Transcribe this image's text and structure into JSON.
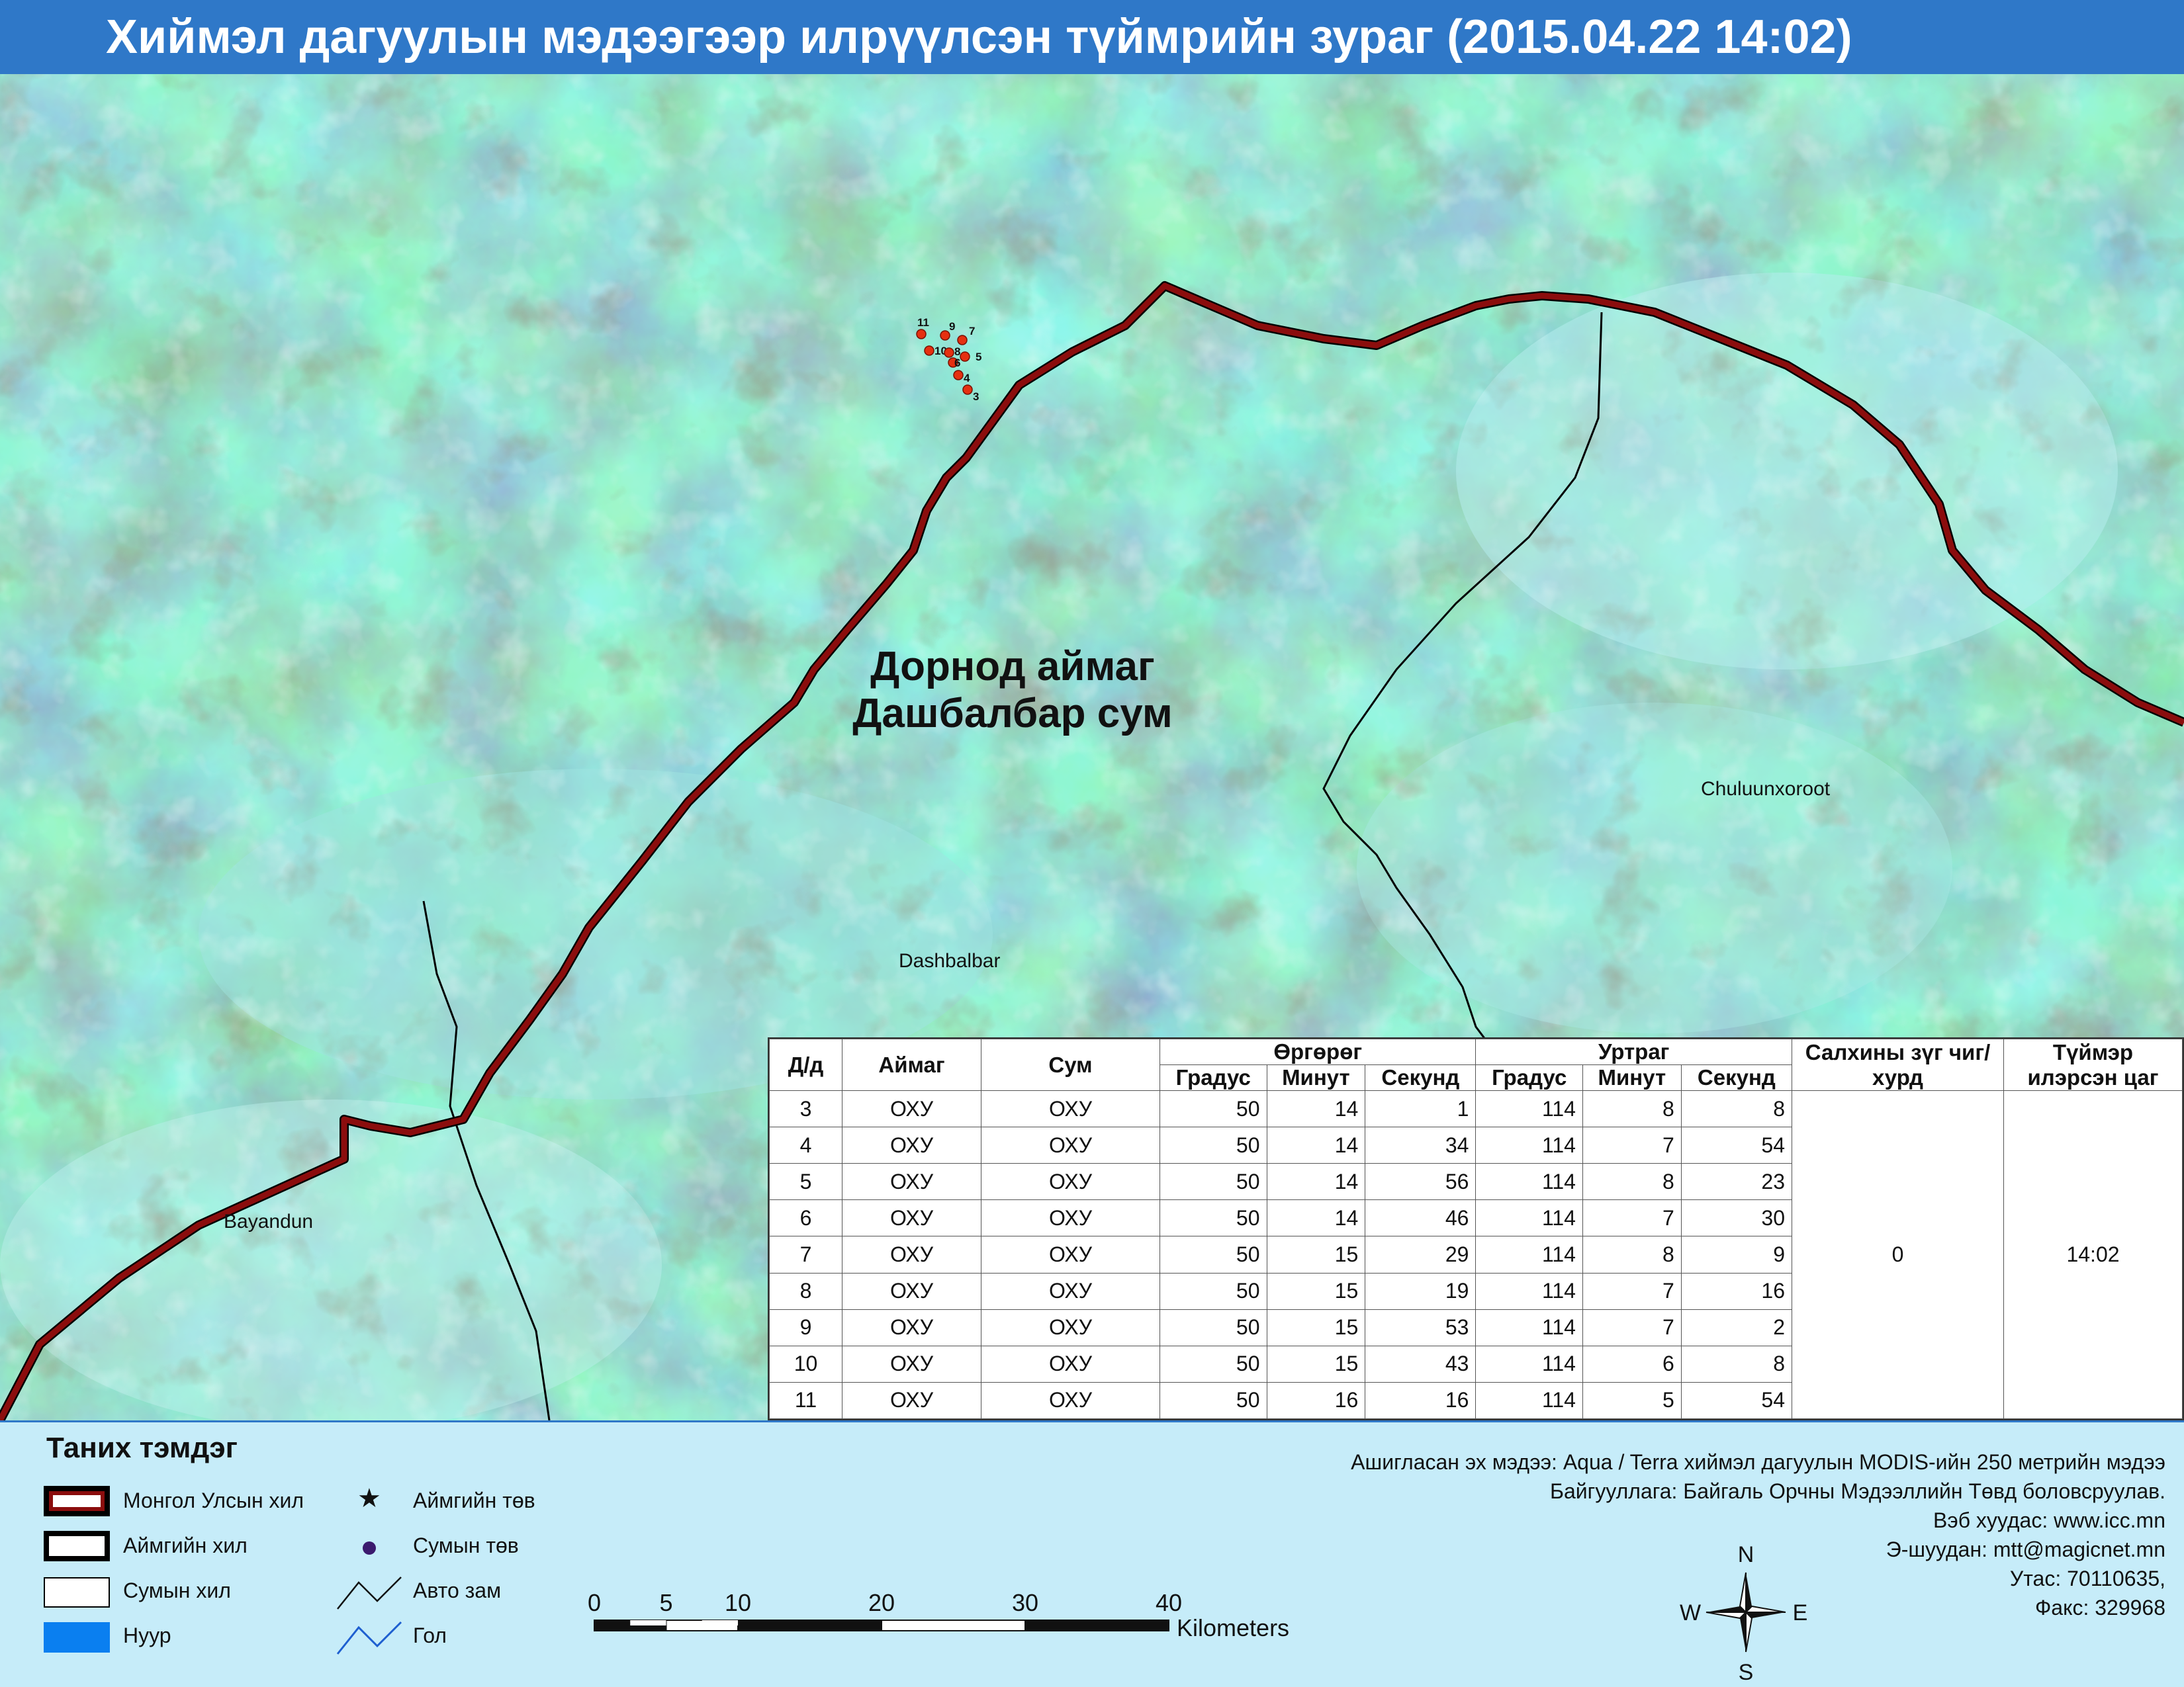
{
  "title": "Хиймэл дагуулын мэдээгээр илрүүлсэн түймрийн зураг  (2015.04.22 14:02)",
  "map": {
    "region_label_line1": "Дорнод аймаг",
    "region_label_line2": "Дашбалбар сум",
    "place_labels": {
      "chuluunxoroot": "Chuluunxoroot",
      "dashbalbar": "Dashbalbar",
      "bayandun": "Bayandun"
    },
    "fire_points": [
      "11",
      "9",
      "7",
      "10",
      "8",
      "5",
      "6",
      "4",
      "3"
    ],
    "colors": {
      "national_border": "#8b0d0d",
      "fire_point": "#e53010",
      "fire_label": "#111111",
      "soum_border": "#000000"
    }
  },
  "table": {
    "headers": {
      "no": "Д/д",
      "aimag": "Аймаг",
      "soum": "Сум",
      "latitude": "Өргөрөг",
      "longitude": "Уртраг",
      "degree": "Градус",
      "minute": "Минут",
      "second": "Секунд",
      "wind": "Салхины зүг чиг/хурд",
      "time": "Түймэр илэрсэн цаг"
    },
    "rows": [
      {
        "no": "3",
        "aimag": "ОХУ",
        "soum": "ОХУ",
        "lat_d": "50",
        "lat_m": "14",
        "lat_s": "1",
        "lon_d": "114",
        "lon_m": "8",
        "lon_s": "8"
      },
      {
        "no": "4",
        "aimag": "ОХУ",
        "soum": "ОХУ",
        "lat_d": "50",
        "lat_m": "14",
        "lat_s": "34",
        "lon_d": "114",
        "lon_m": "7",
        "lon_s": "54"
      },
      {
        "no": "5",
        "aimag": "ОХУ",
        "soum": "ОХУ",
        "lat_d": "50",
        "lat_m": "14",
        "lat_s": "56",
        "lon_d": "114",
        "lon_m": "8",
        "lon_s": "23"
      },
      {
        "no": "6",
        "aimag": "ОХУ",
        "soum": "ОХУ",
        "lat_d": "50",
        "lat_m": "14",
        "lat_s": "46",
        "lon_d": "114",
        "lon_m": "7",
        "lon_s": "30"
      },
      {
        "no": "7",
        "aimag": "ОХУ",
        "soum": "ОХУ",
        "lat_d": "50",
        "lat_m": "15",
        "lat_s": "29",
        "lon_d": "114",
        "lon_m": "8",
        "lon_s": "9"
      },
      {
        "no": "8",
        "aimag": "ОХУ",
        "soum": "ОХУ",
        "lat_d": "50",
        "lat_m": "15",
        "lat_s": "19",
        "lon_d": "114",
        "lon_m": "7",
        "lon_s": "16"
      },
      {
        "no": "9",
        "aimag": "ОХУ",
        "soum": "ОХУ",
        "lat_d": "50",
        "lat_m": "15",
        "lat_s": "53",
        "lon_d": "114",
        "lon_m": "7",
        "lon_s": "2"
      },
      {
        "no": "10",
        "aimag": "ОХУ",
        "soum": "ОХУ",
        "lat_d": "50",
        "lat_m": "15",
        "lat_s": "43",
        "lon_d": "114",
        "lon_m": "6",
        "lon_s": "8"
      },
      {
        "no": "11",
        "aimag": "ОХУ",
        "soum": "ОХУ",
        "lat_d": "50",
        "lat_m": "16",
        "lat_s": "16",
        "lon_d": "114",
        "lon_m": "5",
        "lon_s": "54"
      }
    ],
    "wind_value": "0",
    "time_value": "14:02"
  },
  "legend": {
    "title": "Таних тэмдэг",
    "items": {
      "national_border": "Монгол Улсын хил",
      "aimag_border": "Аймгийн хил",
      "soum_border": "Сумын хил",
      "lake": "Нуур",
      "aimag_center": "Аймгийн төв",
      "soum_center": "Сумын төв",
      "road": "Авто зам",
      "river": "Гол"
    },
    "colors": {
      "national_border": "#8b0d0d",
      "lake": "#0a7ff0",
      "road": "#111111",
      "river": "#1e5fd0",
      "soum_center": "#3b1a6e"
    }
  },
  "scale": {
    "ticks": [
      "0",
      "5",
      "10",
      "20",
      "30",
      "40"
    ],
    "unit": "Kilometers"
  },
  "compass": {
    "n": "N",
    "s": "S",
    "e": "E",
    "w": "W"
  },
  "info": {
    "source": "Ашигласан эх мэдээ: Aqua / Terra хиймэл дагуулын MODIS-ийн 250 метрийн мэдээ",
    "organization": "Байгууллага: Байгаль Орчны Мэдээллийн Төвд боловсруулав.",
    "website": "Вэб хуудас: www.icc.mn",
    "email": "Э-шуудан: mtt@magicnet.mn",
    "phone": "Утас: 70110635,",
    "fax": "Факс: 329968"
  }
}
